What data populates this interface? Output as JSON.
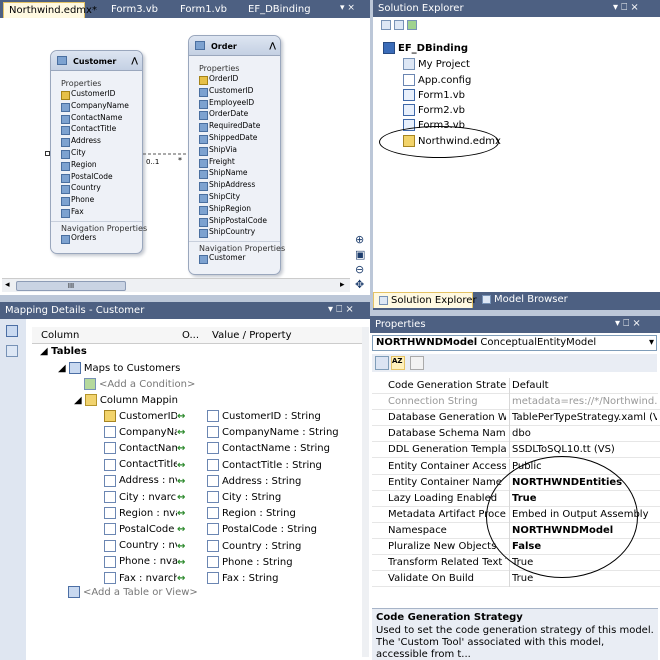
{
  "designer": {
    "tabs": [
      "Northwind.edmx*",
      "Form3.vb",
      "Form1.vb",
      "EF_DBinding"
    ],
    "customer": {
      "title": "Customer",
      "properties_label": "Properties",
      "properties": [
        "CustomerID",
        "CompanyName",
        "ContactName",
        "ContactTitle",
        "Address",
        "City",
        "Region",
        "PostalCode",
        "Country",
        "Phone",
        "Fax"
      ],
      "nav_label": "Navigation Properties",
      "nav": [
        "Orders"
      ]
    },
    "order": {
      "title": "Order",
      "properties_label": "Properties",
      "properties": [
        "OrderID",
        "CustomerID",
        "EmployeeID",
        "OrderDate",
        "RequiredDate",
        "ShippedDate",
        "ShipVia",
        "Freight",
        "ShipName",
        "ShipAddress",
        "ShipCity",
        "ShipRegion",
        "ShipPostalCode",
        "ShipCountry"
      ],
      "nav_label": "Navigation Properties",
      "nav": [
        "Customer"
      ]
    },
    "multiplicity_left": "0..1",
    "multiplicity_right": "*",
    "scroll_grip": "III"
  },
  "solution_explorer": {
    "title": "Solution Explorer",
    "project": "EF_DBinding",
    "items": [
      "My Project",
      "App.config",
      "Form1.vb",
      "Form2.vb",
      "Form3.vb",
      "Northwind.edmx"
    ],
    "tabs": [
      "Solution Explorer",
      "Model Browser"
    ]
  },
  "mapping": {
    "title": "Mapping Details - Customer",
    "columns": [
      "Column",
      "O...",
      "Value / Property"
    ],
    "tables_label": "Tables",
    "maps_to": "Maps to Customers",
    "add_condition": "<Add a Condition>",
    "column_mappings": "Column Mappin",
    "rows": [
      {
        "col": "CustomerID : i",
        "prop": "CustomerID : String"
      },
      {
        "col": "CompanyNa",
        "prop": "CompanyName : String"
      },
      {
        "col": "ContactNam",
        "prop": "ContactName : String"
      },
      {
        "col": "ContactTitle",
        "prop": "ContactTitle : String"
      },
      {
        "col": "Address : nva",
        "prop": "Address : String"
      },
      {
        "col": "City : nvarch",
        "prop": "City : String"
      },
      {
        "col": "Region : nvar",
        "prop": "Region : String"
      },
      {
        "col": "PostalCode :",
        "prop": "PostalCode : String"
      },
      {
        "col": "Country : nva",
        "prop": "Country : String"
      },
      {
        "col": "Phone : nvar",
        "prop": "Phone : String"
      },
      {
        "col": "Fax : nvarcha",
        "prop": "Fax : String"
      }
    ],
    "add_table": "<Add a Table or View>"
  },
  "properties": {
    "title": "Properties",
    "object_name": "NORTHWNDModel",
    "object_type": "ConceptualEntityModel",
    "rows": [
      {
        "name": "Code Generation Strategy",
        "value": "Default",
        "bold": false,
        "disabled": false
      },
      {
        "name": "Connection String",
        "value": "metadata=res://*/Northwind.c",
        "bold": false,
        "disabled": true
      },
      {
        "name": "Database Generation Work",
        "value": "TablePerTypeStrategy.xaml (VS)",
        "bold": false,
        "disabled": false
      },
      {
        "name": "Database Schema Name",
        "value": "dbo",
        "bold": false,
        "disabled": false
      },
      {
        "name": "DDL Generation Template",
        "value": "SSDLToSQL10.tt (VS)",
        "bold": false,
        "disabled": false
      },
      {
        "name": "Entity Container Access",
        "value": "Public",
        "bold": false,
        "disabled": false
      },
      {
        "name": "Entity Container Name",
        "value": "NORTHWNDEntities",
        "bold": true,
        "disabled": false
      },
      {
        "name": "Lazy Loading Enabled",
        "value": "True",
        "bold": true,
        "disabled": false
      },
      {
        "name": "Metadata Artifact Processi",
        "value": "Embed in Output Assembly",
        "bold": false,
        "disabled": false
      },
      {
        "name": "Namespace",
        "value": "NORTHWNDModel",
        "bold": true,
        "disabled": false
      },
      {
        "name": "Pluralize New Objects",
        "value": "False",
        "bold": true,
        "disabled": false
      },
      {
        "name": "Transform Related Text Te",
        "value": "True",
        "bold": false,
        "disabled": false
      },
      {
        "name": "Validate On Build",
        "value": "True",
        "bold": false,
        "disabled": false
      }
    ],
    "desc_title": "Code Generation Strategy",
    "desc_text": "Used to set the code generation strategy of this model. The 'Custom Tool' associated with this model, accessible from t..."
  },
  "panel_controls": "▾ ⎕ ×",
  "colors": {
    "titlebar": "#4d6082",
    "active_tab": "#fff9e1",
    "accent": "#3399ff"
  }
}
